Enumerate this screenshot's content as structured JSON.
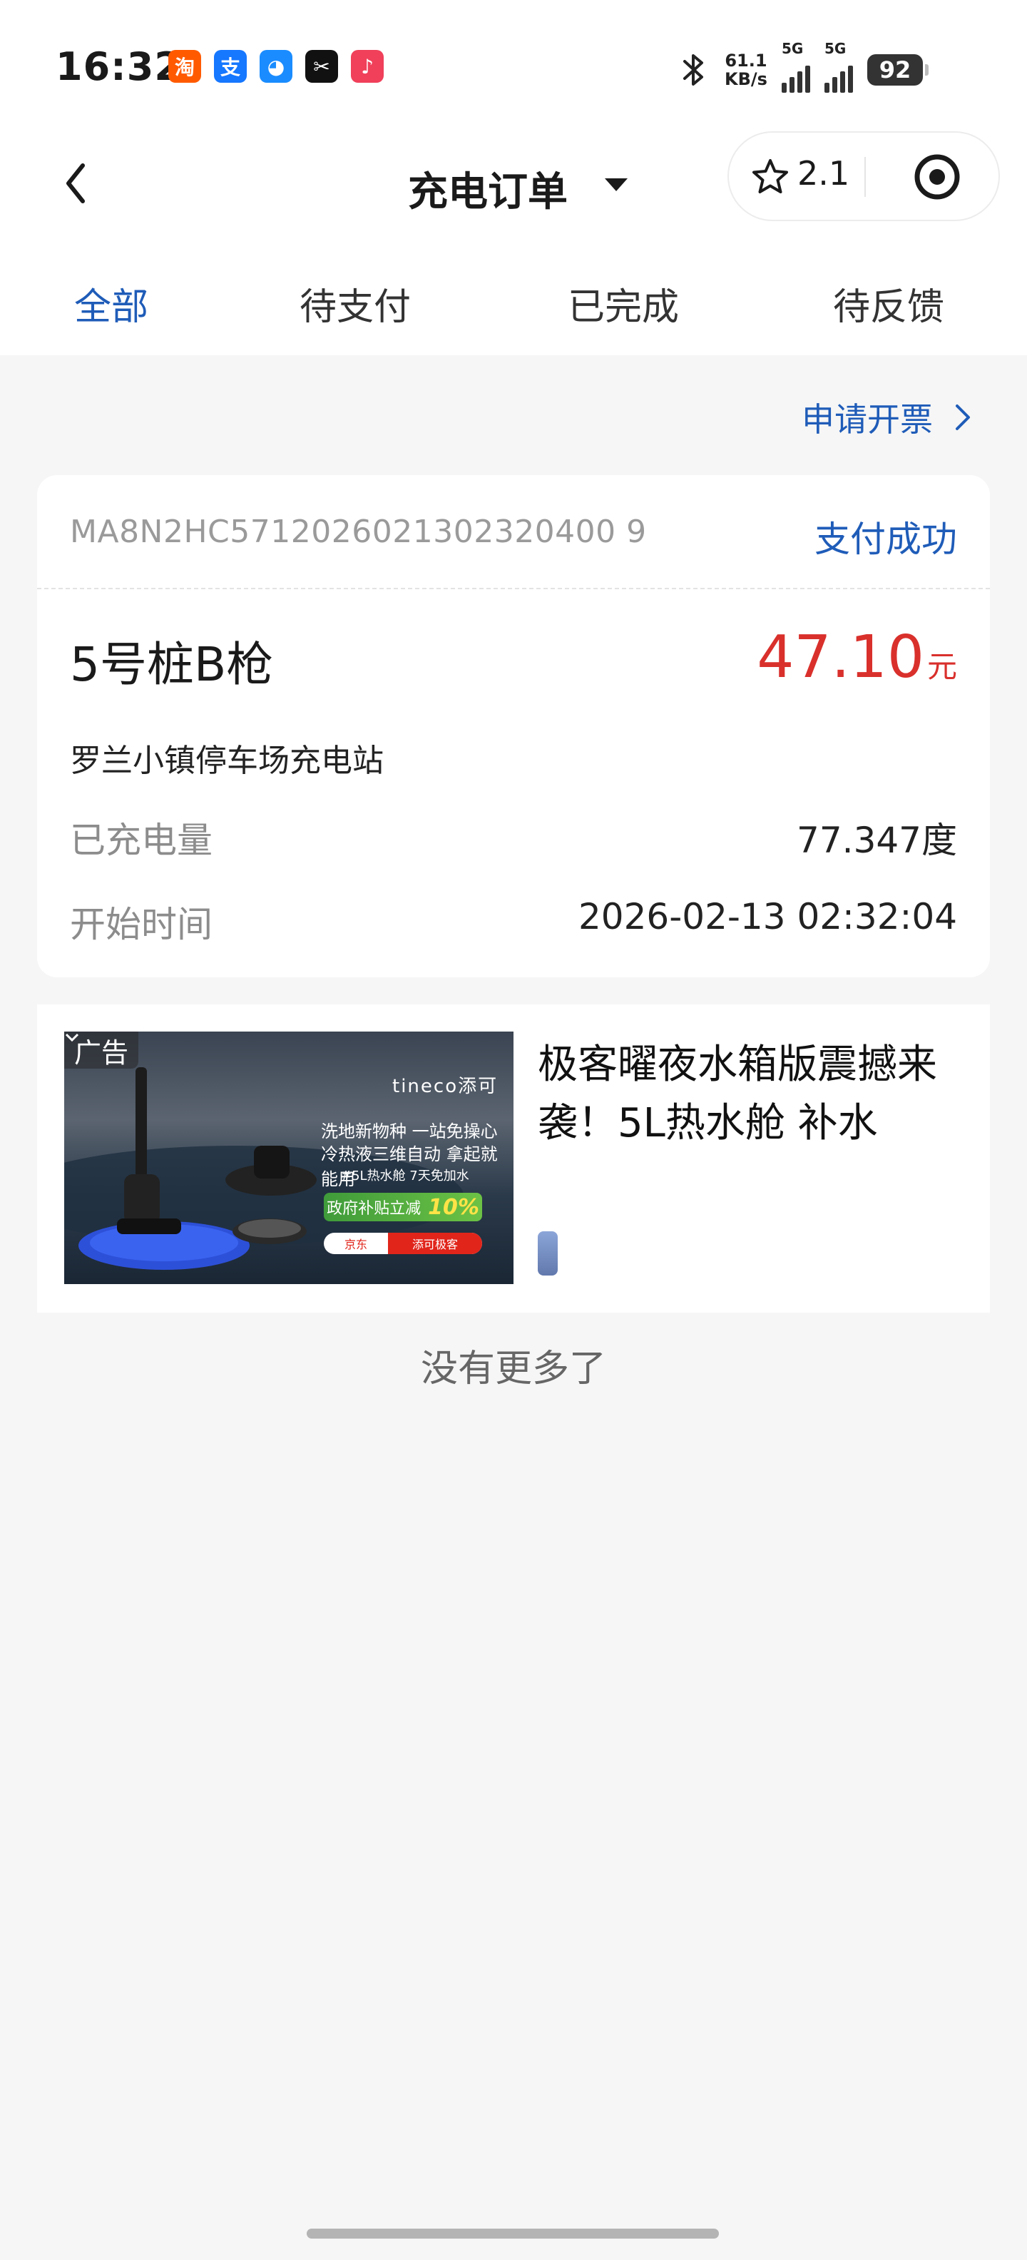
{
  "status_bar": {
    "time": "16:32",
    "apps": [
      {
        "name": "taobao-icon",
        "glyph": "淘",
        "color": "#ff5a00"
      },
      {
        "name": "alipay-icon",
        "glyph": "支",
        "color": "#1677ff"
      },
      {
        "name": "browser-icon",
        "glyph": "◕",
        "color": "#1a8cff"
      },
      {
        "name": "capcut-icon",
        "glyph": "✂",
        "color": "#111111"
      },
      {
        "name": "music-icon",
        "glyph": "♪",
        "color": "#f0405a"
      }
    ],
    "net_speed_value": "61.1",
    "net_speed_unit": "KB/s",
    "signal1_label": "5G",
    "signal2_label": "5G",
    "battery": "92"
  },
  "nav": {
    "title": "充电订单",
    "rating": "2.1"
  },
  "tabs": [
    {
      "label": "全部",
      "active": true
    },
    {
      "label": "待支付",
      "active": false
    },
    {
      "label": "已完成",
      "active": false
    },
    {
      "label": "待反馈",
      "active": false
    }
  ],
  "invoice_link": "申请开票",
  "order": {
    "order_no": "MA8N2HC5712026021302320400 9",
    "status": "支付成功",
    "pile": "5号桩B枪",
    "amount": "47.10",
    "amount_unit": "元",
    "station": "罗兰小镇停车场充电站",
    "rows": [
      {
        "label": "已充电量",
        "value": "77.347度"
      },
      {
        "label": "开始时间",
        "value": "2026-02-13 02:32:04"
      }
    ]
  },
  "ad": {
    "tag": "广告",
    "title": "极客曜夜水箱版震撼来袭！5L热水舱 补水",
    "image_brand": "tineco添可",
    "image_line1": "洗地新物种 一站免操心",
    "image_line2": "冷热液三维自动 拿起就能用",
    "image_line3": "#5L热水舱 7天免加水",
    "image_subsidy": "政府补贴立减",
    "image_subsidy_pct": "10%",
    "image_jd": "京东",
    "image_jd_store": "添可极客"
  },
  "footer": {
    "no_more": "没有更多了"
  },
  "colors": {
    "accent_blue": "#1f5cb8",
    "price_red": "#d9302c"
  }
}
